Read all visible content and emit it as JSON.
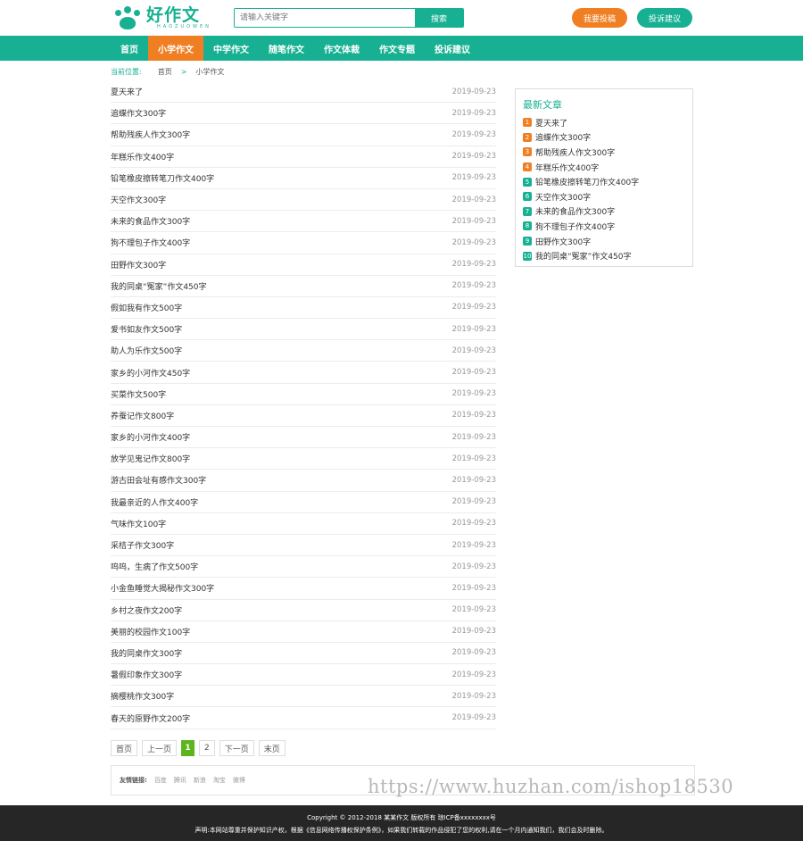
{
  "header": {
    "logo_title": "好作文",
    "logo_sub": "HAOZUOWEN",
    "search_placeholder": "请输入关键字",
    "search_button": "搜索",
    "submit_button": "我要投稿",
    "complaint_button": "投诉建议"
  },
  "nav": {
    "items": [
      {
        "label": "首页"
      },
      {
        "label": "小学作文"
      },
      {
        "label": "中学作文"
      },
      {
        "label": "随笔作文"
      },
      {
        "label": "作文体裁"
      },
      {
        "label": "作文专题"
      },
      {
        "label": "投诉建议"
      }
    ],
    "active_index": 1
  },
  "breadcrumb": {
    "label": "当前位置:",
    "home": "首页",
    "separator": ">",
    "current": "小学作文"
  },
  "articles": [
    {
      "title": "夏天来了",
      "date": "2019-09-23"
    },
    {
      "title": "追蝶作文300字",
      "date": "2019-09-23"
    },
    {
      "title": "帮助残疾人作文300字",
      "date": "2019-09-23"
    },
    {
      "title": "年糕乐作文400字",
      "date": "2019-09-23"
    },
    {
      "title": "铅笔橡皮擦转笔刀作文400字",
      "date": "2019-09-23"
    },
    {
      "title": "天空作文300字",
      "date": "2019-09-23"
    },
    {
      "title": "未来的食品作文300字",
      "date": "2019-09-23"
    },
    {
      "title": "狗不理包子作文400字",
      "date": "2019-09-23"
    },
    {
      "title": "田野作文300字",
      "date": "2019-09-23"
    },
    {
      "title": "我的同桌“冤家”作文450字",
      "date": "2019-09-23"
    },
    {
      "title": "假如我有作文500字",
      "date": "2019-09-23"
    },
    {
      "title": "爱书如友作文500字",
      "date": "2019-09-23"
    },
    {
      "title": "助人为乐作文500字",
      "date": "2019-09-23"
    },
    {
      "title": "家乡的小河作文450字",
      "date": "2019-09-23"
    },
    {
      "title": "买菜作文500字",
      "date": "2019-09-23"
    },
    {
      "title": "养蚕记作文800字",
      "date": "2019-09-23"
    },
    {
      "title": "家乡的小河作文400字",
      "date": "2019-09-23"
    },
    {
      "title": "放学见鬼记作文800字",
      "date": "2019-09-23"
    },
    {
      "title": "游古田会址有感作文300字",
      "date": "2019-09-23"
    },
    {
      "title": "我最亲近的人作文400字",
      "date": "2019-09-23"
    },
    {
      "title": "气味作文100字",
      "date": "2019-09-23"
    },
    {
      "title": "采桔子作文300字",
      "date": "2019-09-23"
    },
    {
      "title": "呜呜，生病了作文500字",
      "date": "2019-09-23"
    },
    {
      "title": "小金鱼睡觉大揭秘作文300字",
      "date": "2019-09-23"
    },
    {
      "title": "乡村之夜作文200字",
      "date": "2019-09-23"
    },
    {
      "title": "美丽的校园作文100字",
      "date": "2019-09-23"
    },
    {
      "title": "我的同桌作文300字",
      "date": "2019-09-23"
    },
    {
      "title": "暑假印象作文300字",
      "date": "2019-09-23"
    },
    {
      "title": "摘樱桃作文300字",
      "date": "2019-09-23"
    },
    {
      "title": "春天的原野作文200字",
      "date": "2019-09-23"
    }
  ],
  "sidebar": {
    "title": "最新文章",
    "items": [
      {
        "num": "1",
        "title": "夏天来了",
        "color": "#f07f24"
      },
      {
        "num": "2",
        "title": "追蝶作文300字",
        "color": "#f07f24"
      },
      {
        "num": "3",
        "title": "帮助残疾人作文300字",
        "color": "#f07f24"
      },
      {
        "num": "4",
        "title": "年糕乐作文400字",
        "color": "#f07f24"
      },
      {
        "num": "5",
        "title": "铅笔橡皮擦转笔刀作文400字",
        "color": "#18b092"
      },
      {
        "num": "6",
        "title": "天空作文300字",
        "color": "#18b092"
      },
      {
        "num": "7",
        "title": "未来的食品作文300字",
        "color": "#18b092"
      },
      {
        "num": "8",
        "title": "狗不理包子作文400字",
        "color": "#18b092"
      },
      {
        "num": "9",
        "title": "田野作文300字",
        "color": "#18b092"
      },
      {
        "num": "10",
        "title": "我的同桌“冤家”作文450字",
        "color": "#18b092"
      }
    ]
  },
  "pagination": {
    "first": "首页",
    "prev": "上一页",
    "pages": [
      "1",
      "2"
    ],
    "active_page": "1",
    "next": "下一页",
    "last": "末页"
  },
  "friend_links": {
    "label": "友情链接:",
    "items": [
      "百度",
      "腾讯",
      "新浪",
      "淘宝",
      "微博"
    ]
  },
  "watermark": "https://www.huzhan.com/ishop18530",
  "footer": {
    "copyright": "Copyright © 2012-2018 某某作文 版权所有   琼ICP备xxxxxxxx号",
    "notice": "声明:本网站尊重并保护知识产权，根据《信息网络传播权保护条例》，如果我们转载的作品侵犯了您的权利,请在一个月内通知我们，我们会及时删除。"
  },
  "colors": {
    "brand": "#18b092",
    "accent": "#f07f24",
    "page_active": "#5cb51e",
    "footer_bg": "#262626"
  }
}
